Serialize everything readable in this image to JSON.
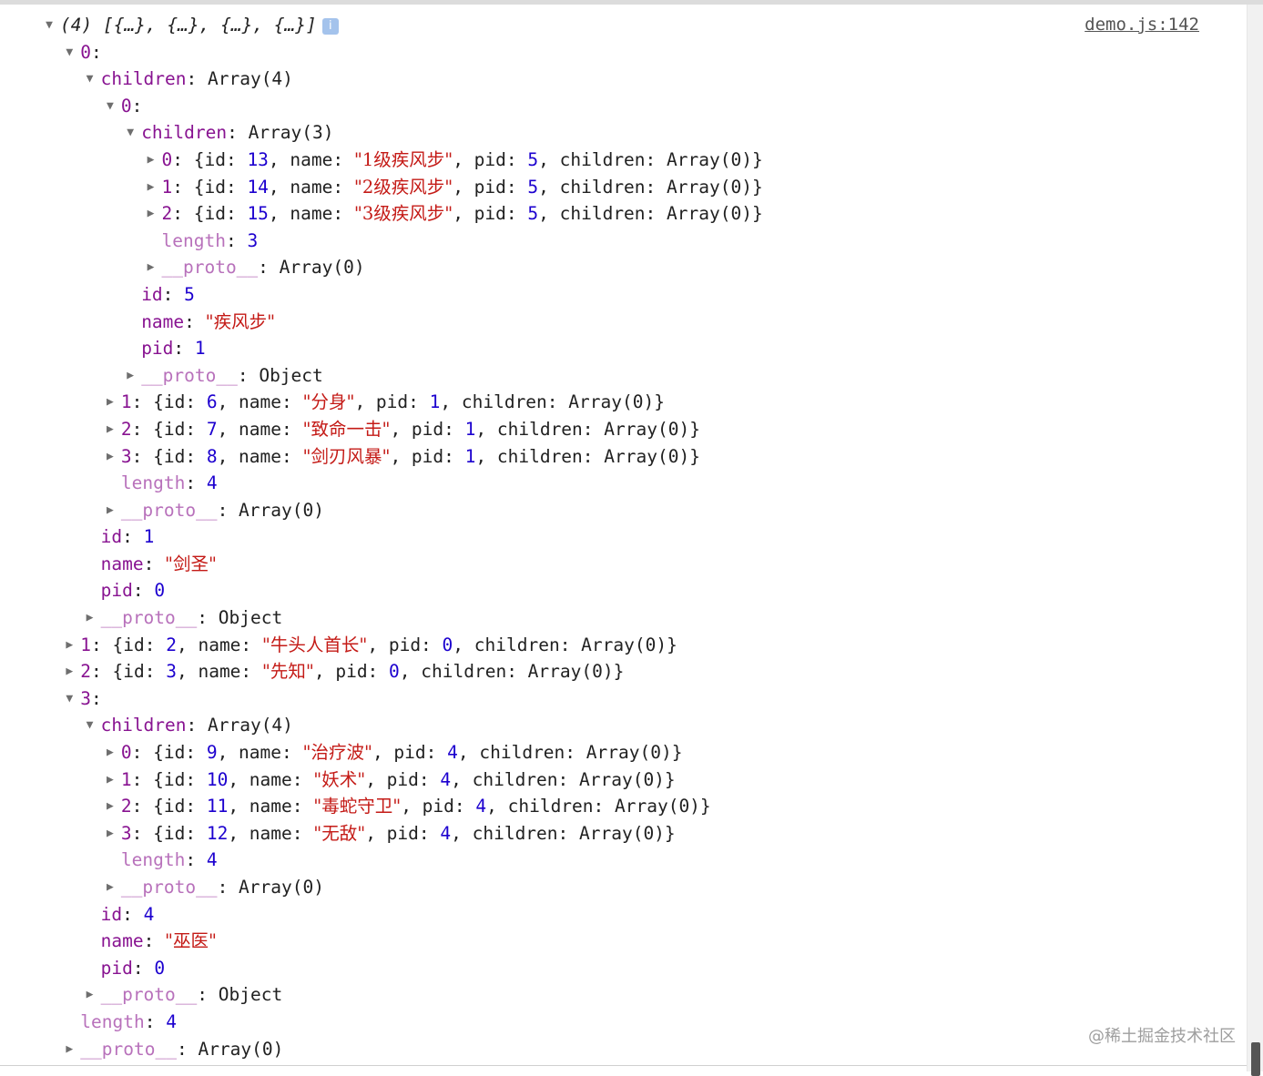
{
  "log": {
    "source": "demo.js:142",
    "info_icon": "i",
    "watermark": "@稀土掘金技术社区",
    "lines": [
      {
        "d": 0,
        "a": "down",
        "head": true,
        "t": [
          [
            "p",
            "(4) [{…}, {…}, {…}, {…}]"
          ]
        ]
      },
      {
        "d": 1,
        "a": "down",
        "t": [
          [
            "k",
            "0"
          ],
          [
            "p",
            ":"
          ]
        ]
      },
      {
        "d": 2,
        "a": "down",
        "t": [
          [
            "k",
            "children"
          ],
          [
            "p",
            ": Array(4)"
          ]
        ]
      },
      {
        "d": 3,
        "a": "down",
        "t": [
          [
            "k",
            "0"
          ],
          [
            "p",
            ":"
          ]
        ]
      },
      {
        "d": 4,
        "a": "down",
        "t": [
          [
            "k",
            "children"
          ],
          [
            "p",
            ": Array(3)"
          ]
        ]
      },
      {
        "d": 5,
        "a": "right",
        "t": [
          [
            "k",
            "0"
          ],
          [
            "p",
            ": {id: "
          ],
          [
            "n",
            "13"
          ],
          [
            "p",
            ", name: "
          ],
          [
            "s",
            "\"1级疾风步\""
          ],
          [
            "p",
            ", pid: "
          ],
          [
            "n",
            "5"
          ],
          [
            "p",
            ", children: Array(0)}"
          ]
        ]
      },
      {
        "d": 5,
        "a": "right",
        "t": [
          [
            "k",
            "1"
          ],
          [
            "p",
            ": {id: "
          ],
          [
            "n",
            "14"
          ],
          [
            "p",
            ", name: "
          ],
          [
            "s",
            "\"2级疾风步\""
          ],
          [
            "p",
            ", pid: "
          ],
          [
            "n",
            "5"
          ],
          [
            "p",
            ", children: Array(0)}"
          ]
        ]
      },
      {
        "d": 5,
        "a": "right",
        "t": [
          [
            "k",
            "2"
          ],
          [
            "p",
            ": {id: "
          ],
          [
            "n",
            "15"
          ],
          [
            "p",
            ", name: "
          ],
          [
            "s",
            "\"3级疾风步\""
          ],
          [
            "p",
            ", pid: "
          ],
          [
            "n",
            "5"
          ],
          [
            "p",
            ", children: Array(0)}"
          ]
        ]
      },
      {
        "d": 5,
        "a": "none",
        "t": [
          [
            "kp",
            "length"
          ],
          [
            "p",
            ": "
          ],
          [
            "n",
            "3"
          ]
        ]
      },
      {
        "d": 5,
        "a": "right",
        "t": [
          [
            "kp",
            "__proto__"
          ],
          [
            "p",
            ": Array(0)"
          ]
        ]
      },
      {
        "d": 4,
        "a": "none",
        "t": [
          [
            "k",
            "id"
          ],
          [
            "p",
            ": "
          ],
          [
            "n",
            "5"
          ]
        ]
      },
      {
        "d": 4,
        "a": "none",
        "t": [
          [
            "k",
            "name"
          ],
          [
            "p",
            ": "
          ],
          [
            "s",
            "\"疾风步\""
          ]
        ]
      },
      {
        "d": 4,
        "a": "none",
        "t": [
          [
            "k",
            "pid"
          ],
          [
            "p",
            ": "
          ],
          [
            "n",
            "1"
          ]
        ]
      },
      {
        "d": 4,
        "a": "right",
        "t": [
          [
            "kp",
            "__proto__"
          ],
          [
            "p",
            ": Object"
          ]
        ]
      },
      {
        "d": 3,
        "a": "right",
        "t": [
          [
            "k",
            "1"
          ],
          [
            "p",
            ": {id: "
          ],
          [
            "n",
            "6"
          ],
          [
            "p",
            ", name: "
          ],
          [
            "s",
            "\"分身\""
          ],
          [
            "p",
            ", pid: "
          ],
          [
            "n",
            "1"
          ],
          [
            "p",
            ", children: Array(0)}"
          ]
        ]
      },
      {
        "d": 3,
        "a": "right",
        "t": [
          [
            "k",
            "2"
          ],
          [
            "p",
            ": {id: "
          ],
          [
            "n",
            "7"
          ],
          [
            "p",
            ", name: "
          ],
          [
            "s",
            "\"致命一击\""
          ],
          [
            "p",
            ", pid: "
          ],
          [
            "n",
            "1"
          ],
          [
            "p",
            ", children: Array(0)}"
          ]
        ]
      },
      {
        "d": 3,
        "a": "right",
        "t": [
          [
            "k",
            "3"
          ],
          [
            "p",
            ": {id: "
          ],
          [
            "n",
            "8"
          ],
          [
            "p",
            ", name: "
          ],
          [
            "s",
            "\"剑刃风暴\""
          ],
          [
            "p",
            ", pid: "
          ],
          [
            "n",
            "1"
          ],
          [
            "p",
            ", children: Array(0)}"
          ]
        ]
      },
      {
        "d": 3,
        "a": "none",
        "t": [
          [
            "kp",
            "length"
          ],
          [
            "p",
            ": "
          ],
          [
            "n",
            "4"
          ]
        ]
      },
      {
        "d": 3,
        "a": "right",
        "t": [
          [
            "kp",
            "__proto__"
          ],
          [
            "p",
            ": Array(0)"
          ]
        ]
      },
      {
        "d": 2,
        "a": "none",
        "t": [
          [
            "k",
            "id"
          ],
          [
            "p",
            ": "
          ],
          [
            "n",
            "1"
          ]
        ]
      },
      {
        "d": 2,
        "a": "none",
        "t": [
          [
            "k",
            "name"
          ],
          [
            "p",
            ": "
          ],
          [
            "s",
            "\"剑圣\""
          ]
        ]
      },
      {
        "d": 2,
        "a": "none",
        "t": [
          [
            "k",
            "pid"
          ],
          [
            "p",
            ": "
          ],
          [
            "n",
            "0"
          ]
        ]
      },
      {
        "d": 2,
        "a": "right",
        "t": [
          [
            "kp",
            "__proto__"
          ],
          [
            "p",
            ": Object"
          ]
        ]
      },
      {
        "d": 1,
        "a": "right",
        "t": [
          [
            "k",
            "1"
          ],
          [
            "p",
            ": {id: "
          ],
          [
            "n",
            "2"
          ],
          [
            "p",
            ", name: "
          ],
          [
            "s",
            "\"牛头人首长\""
          ],
          [
            "p",
            ", pid: "
          ],
          [
            "n",
            "0"
          ],
          [
            "p",
            ", children: Array(0)}"
          ]
        ]
      },
      {
        "d": 1,
        "a": "right",
        "t": [
          [
            "k",
            "2"
          ],
          [
            "p",
            ": {id: "
          ],
          [
            "n",
            "3"
          ],
          [
            "p",
            ", name: "
          ],
          [
            "s",
            "\"先知\""
          ],
          [
            "p",
            ", pid: "
          ],
          [
            "n",
            "0"
          ],
          [
            "p",
            ", children: Array(0)}"
          ]
        ]
      },
      {
        "d": 1,
        "a": "down",
        "t": [
          [
            "k",
            "3"
          ],
          [
            "p",
            ":"
          ]
        ]
      },
      {
        "d": 2,
        "a": "down",
        "t": [
          [
            "k",
            "children"
          ],
          [
            "p",
            ": Array(4)"
          ]
        ]
      },
      {
        "d": 3,
        "a": "right",
        "t": [
          [
            "k",
            "0"
          ],
          [
            "p",
            ": {id: "
          ],
          [
            "n",
            "9"
          ],
          [
            "p",
            ", name: "
          ],
          [
            "s",
            "\"治疗波\""
          ],
          [
            "p",
            ", pid: "
          ],
          [
            "n",
            "4"
          ],
          [
            "p",
            ", children: Array(0)}"
          ]
        ]
      },
      {
        "d": 3,
        "a": "right",
        "t": [
          [
            "k",
            "1"
          ],
          [
            "p",
            ": {id: "
          ],
          [
            "n",
            "10"
          ],
          [
            "p",
            ", name: "
          ],
          [
            "s",
            "\"妖术\""
          ],
          [
            "p",
            ", pid: "
          ],
          [
            "n",
            "4"
          ],
          [
            "p",
            ", children: Array(0)}"
          ]
        ]
      },
      {
        "d": 3,
        "a": "right",
        "t": [
          [
            "k",
            "2"
          ],
          [
            "p",
            ": {id: "
          ],
          [
            "n",
            "11"
          ],
          [
            "p",
            ", name: "
          ],
          [
            "s",
            "\"毒蛇守卫\""
          ],
          [
            "p",
            ", pid: "
          ],
          [
            "n",
            "4"
          ],
          [
            "p",
            ", children: Array(0)}"
          ]
        ]
      },
      {
        "d": 3,
        "a": "right",
        "t": [
          [
            "k",
            "3"
          ],
          [
            "p",
            ": {id: "
          ],
          [
            "n",
            "12"
          ],
          [
            "p",
            ", name: "
          ],
          [
            "s",
            "\"无敌\""
          ],
          [
            "p",
            ", pid: "
          ],
          [
            "n",
            "4"
          ],
          [
            "p",
            ", children: Array(0)}"
          ]
        ]
      },
      {
        "d": 3,
        "a": "none",
        "t": [
          [
            "kp",
            "length"
          ],
          [
            "p",
            ": "
          ],
          [
            "n",
            "4"
          ]
        ]
      },
      {
        "d": 3,
        "a": "right",
        "t": [
          [
            "kp",
            "__proto__"
          ],
          [
            "p",
            ": Array(0)"
          ]
        ]
      },
      {
        "d": 2,
        "a": "none",
        "t": [
          [
            "k",
            "id"
          ],
          [
            "p",
            ": "
          ],
          [
            "n",
            "4"
          ]
        ]
      },
      {
        "d": 2,
        "a": "none",
        "t": [
          [
            "k",
            "name"
          ],
          [
            "p",
            ": "
          ],
          [
            "s",
            "\"巫医\""
          ]
        ]
      },
      {
        "d": 2,
        "a": "none",
        "t": [
          [
            "k",
            "pid"
          ],
          [
            "p",
            ": "
          ],
          [
            "n",
            "0"
          ]
        ]
      },
      {
        "d": 2,
        "a": "right",
        "t": [
          [
            "kp",
            "__proto__"
          ],
          [
            "p",
            ": Object"
          ]
        ]
      },
      {
        "d": 1,
        "a": "none",
        "t": [
          [
            "kp",
            "length"
          ],
          [
            "p",
            ": "
          ],
          [
            "n",
            "4"
          ]
        ]
      },
      {
        "d": 1,
        "a": "right",
        "t": [
          [
            "kp",
            "__proto__"
          ],
          [
            "p",
            ": Array(0)"
          ]
        ]
      }
    ]
  }
}
